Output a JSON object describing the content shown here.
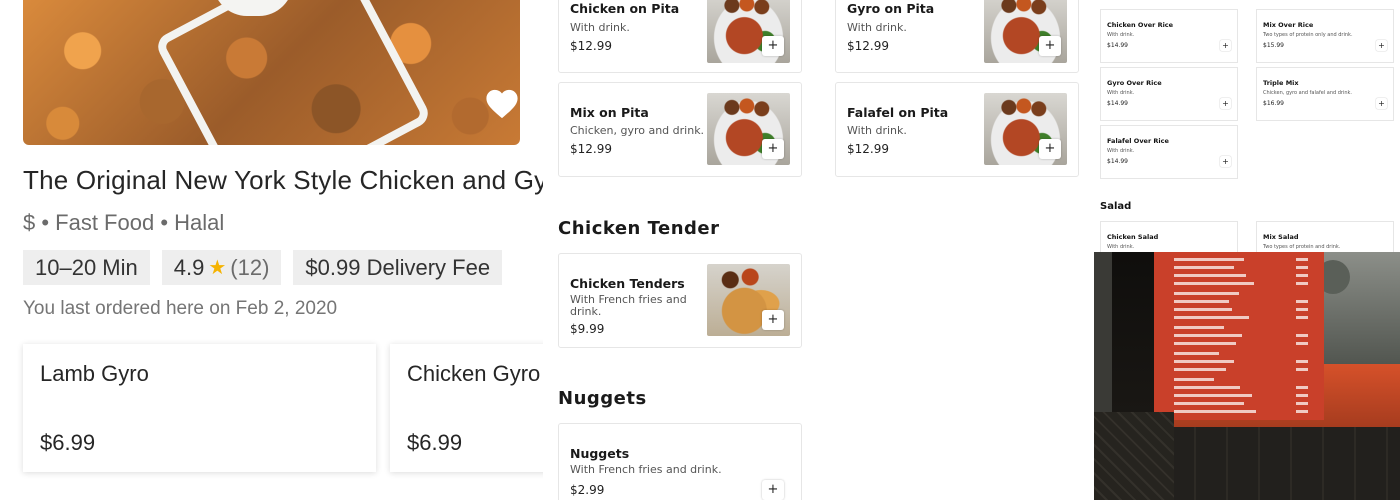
{
  "store": {
    "name": "The Original New York Style Chicken and Gyro",
    "meta": "$ • Fast Food • Halal",
    "delivery_time": "10–20 Min",
    "rating": "4.9",
    "rating_count": "(12)",
    "delivery_fee": "$0.99 Delivery Fee",
    "last_ordered": "You last ordered here on Feb 2, 2020"
  },
  "icons": {
    "favorite": "heart-icon",
    "star": "star-icon",
    "add": "plus-icon"
  },
  "reorder": [
    {
      "name": "Lamb Gyro",
      "price": "$6.99"
    },
    {
      "name": "Chicken Gyro",
      "price": "$6.99"
    }
  ],
  "menu": {
    "pitas": [
      {
        "name": "Chicken on Pita",
        "desc": "With drink.",
        "price": "$12.99"
      },
      {
        "name": "Gyro on Pita",
        "desc": "With drink.",
        "price": "$12.99"
      },
      {
        "name": "Mix on Pita",
        "desc": "Chicken, gyro and drink.",
        "price": "$12.99"
      },
      {
        "name": "Falafel on Pita",
        "desc": "With drink.",
        "price": "$12.99"
      }
    ],
    "chicken_tender_title": "Chicken Tender",
    "chicken_tenders": {
      "name": "Chicken Tenders",
      "desc": "With French fries and drink.",
      "price": "$9.99"
    },
    "nuggets_title": "Nuggets",
    "nuggets": {
      "name": "Nuggets",
      "desc": "With French fries and drink.",
      "price": "$2.99"
    },
    "add_label": "+"
  },
  "right_menu": {
    "rice": [
      {
        "name": "Chicken Over Rice",
        "desc": "With drink.",
        "price": "$14.99"
      },
      {
        "name": "Mix Over Rice",
        "desc": "Two types of protein only and drink.",
        "price": "$15.99"
      },
      {
        "name": "Gyro Over Rice",
        "desc": "With drink.",
        "price": "$14.99"
      },
      {
        "name": "Triple Mix",
        "desc": "Chicken, gyro and falafel and drink.",
        "price": "$16.99"
      },
      {
        "name": "Falafel Over Rice",
        "desc": "With drink.",
        "price": "$14.99"
      }
    ],
    "salad_title": "Salad",
    "salads": [
      {
        "name": "Chicken Salad",
        "desc": "With drink."
      },
      {
        "name": "Mix Salad",
        "desc": "Two types of protein and drink."
      }
    ]
  },
  "colors": {
    "heart": "#ffffff",
    "star": "#f5b301",
    "pill_bg": "#eeeeee",
    "menu_board": "#c9402a"
  }
}
